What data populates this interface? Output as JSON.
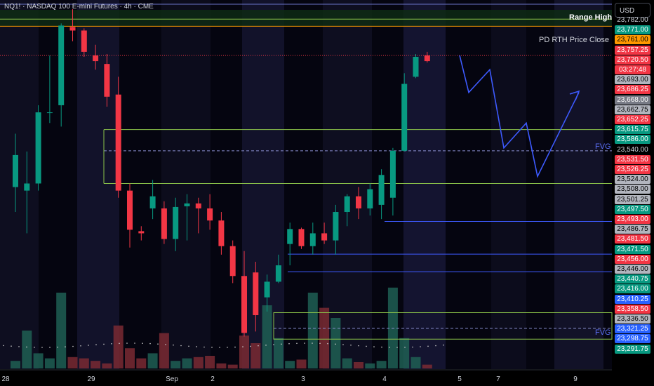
{
  "symbol_title": "NQ1! · NASDAQ 100 E-mini Futures · 4h · CME",
  "currency": "USD",
  "annotations": {
    "range_high": "Range High",
    "pd_rth_close": "PD RTH Price Close",
    "fvg_upper": "FVG",
    "fvg_lower": "FVG"
  },
  "time_labels": [
    "28",
    "29",
    "Sep",
    "2",
    "3",
    "4",
    "5",
    "7",
    "9"
  ],
  "price_labels": [
    {
      "text": "23,782.00",
      "style": "plain"
    },
    {
      "text": "23,771.00",
      "style": "green"
    },
    {
      "text": "23,761.00",
      "style": "orange"
    },
    {
      "text": "23,757.25",
      "style": "red"
    },
    {
      "text": "23,720.50",
      "style": "red"
    },
    {
      "text": "03:27:48",
      "style": "red"
    },
    {
      "text": "23,693.00",
      "style": "gray"
    },
    {
      "text": "23,686.25",
      "style": "red"
    },
    {
      "text": "23,668.00",
      "style": "darkgray"
    },
    {
      "text": "23,662.75",
      "style": "gray"
    },
    {
      "text": "23,652.25",
      "style": "red"
    },
    {
      "text": "23,615.75",
      "style": "green"
    },
    {
      "text": "23,586.00",
      "style": "green"
    },
    {
      "text": "23,540.00",
      "style": "plain"
    },
    {
      "text": "23,531.50",
      "style": "red"
    },
    {
      "text": "23,526.25",
      "style": "red"
    },
    {
      "text": "23,524.00",
      "style": "gray"
    },
    {
      "text": "23,508.00",
      "style": "gray"
    },
    {
      "text": "23,501.25",
      "style": "gray"
    },
    {
      "text": "23,497.50",
      "style": "green"
    },
    {
      "text": "23,493.00",
      "style": "red"
    },
    {
      "text": "23,486.75",
      "style": "gray"
    },
    {
      "text": "23,481.50",
      "style": "red"
    },
    {
      "text": "23,471.50",
      "style": "green"
    },
    {
      "text": "23,456.00",
      "style": "red"
    },
    {
      "text": "23,446.00",
      "style": "gray"
    },
    {
      "text": "23,440.75",
      "style": "green"
    },
    {
      "text": "23,416.00",
      "style": "green"
    },
    {
      "text": "23,410.25",
      "style": "blue"
    },
    {
      "text": "23,358.50",
      "style": "red"
    },
    {
      "text": "23,336.50",
      "style": "gray"
    },
    {
      "text": "23,321.25",
      "style": "blue"
    },
    {
      "text": "23,298.75",
      "style": "blue"
    },
    {
      "text": "23,291.75",
      "style": "green"
    }
  ],
  "colors": {
    "up": "#089981",
    "down": "#f23645",
    "level_green": "#8bc34a",
    "pd_close": "#ff9800",
    "projection": "#3d5afe",
    "fvg_line": "#5b6ef5"
  },
  "chart_data": {
    "type": "candlestick",
    "symbol": "NQ1!",
    "timeframe": "4h",
    "y_axis": {
      "min": 23285,
      "max": 23790
    },
    "candles": [
      {
        "o": 23535,
        "h": 23610,
        "l": 23500,
        "c": 23580
      },
      {
        "o": 23530,
        "h": 23585,
        "l": 23470,
        "c": 23540
      },
      {
        "o": 23540,
        "h": 23650,
        "l": 23530,
        "c": 23640
      },
      {
        "o": 23640,
        "h": 23720,
        "l": 23625,
        "c": 23640
      },
      {
        "o": 23650,
        "h": 23765,
        "l": 23620,
        "c": 23762
      },
      {
        "o": 23760,
        "h": 23785,
        "l": 23740,
        "c": 23755
      },
      {
        "o": 23755,
        "h": 23758,
        "l": 23718,
        "c": 23725
      },
      {
        "o": 23720,
        "h": 23735,
        "l": 23700,
        "c": 23712
      },
      {
        "o": 23708,
        "h": 23722,
        "l": 23648,
        "c": 23662
      },
      {
        "o": 23665,
        "h": 23690,
        "l": 23520,
        "c": 23530
      },
      {
        "o": 23530,
        "h": 23540,
        "l": 23450,
        "c": 23475
      },
      {
        "o": 23473,
        "h": 23480,
        "l": 23460,
        "c": 23470
      },
      {
        "o": 23505,
        "h": 23545,
        "l": 23490,
        "c": 23522
      },
      {
        "o": 23505,
        "h": 23515,
        "l": 23455,
        "c": 23462
      },
      {
        "o": 23462,
        "h": 23520,
        "l": 23445,
        "c": 23507
      },
      {
        "o": 23508,
        "h": 23525,
        "l": 23460,
        "c": 23512
      },
      {
        "o": 23512,
        "h": 23520,
        "l": 23470,
        "c": 23505
      },
      {
        "o": 23505,
        "h": 23525,
        "l": 23475,
        "c": 23488
      },
      {
        "o": 23488,
        "h": 23500,
        "l": 23440,
        "c": 23452
      },
      {
        "o": 23452,
        "h": 23460,
        "l": 23400,
        "c": 23410
      },
      {
        "o": 23410,
        "h": 23445,
        "l": 23325,
        "c": 23330
      },
      {
        "o": 23415,
        "h": 23430,
        "l": 23332,
        "c": 23355
      },
      {
        "o": 23380,
        "h": 23412,
        "l": 23360,
        "c": 23402
      },
      {
        "o": 23402,
        "h": 23440,
        "l": 23400,
        "c": 23425
      },
      {
        "o": 23455,
        "h": 23485,
        "l": 23425,
        "c": 23476
      },
      {
        "o": 23476,
        "h": 23478,
        "l": 23448,
        "c": 23452
      },
      {
        "o": 23452,
        "h": 23485,
        "l": 23440,
        "c": 23470
      },
      {
        "o": 23470,
        "h": 23485,
        "l": 23455,
        "c": 23460
      },
      {
        "o": 23460,
        "h": 23510,
        "l": 23440,
        "c": 23500
      },
      {
        "o": 23500,
        "h": 23525,
        "l": 23480,
        "c": 23522
      },
      {
        "o": 23522,
        "h": 23535,
        "l": 23490,
        "c": 23505
      },
      {
        "o": 23505,
        "h": 23540,
        "l": 23495,
        "c": 23532
      },
      {
        "o": 23510,
        "h": 23560,
        "l": 23490,
        "c": 23552
      },
      {
        "o": 23520,
        "h": 23590,
        "l": 23495,
        "c": 23586
      },
      {
        "o": 23586,
        "h": 23695,
        "l": 23585,
        "c": 23680
      },
      {
        "o": 23690,
        "h": 23722,
        "l": 23688,
        "c": 23718
      },
      {
        "o": 23720,
        "h": 23725,
        "l": 23710,
        "c": 23712
      }
    ],
    "volume": [
      30,
      150,
      60,
      40,
      300,
      45,
      40,
      30,
      20,
      170,
      80,
      40,
      60,
      140,
      30,
      40,
      45,
      50,
      20,
      15,
      130,
      100,
      250,
      120,
      30,
      35,
      300,
      240,
      200,
      40,
      25,
      20,
      30,
      320,
      120,
      45,
      15
    ],
    "horizontal_levels": [
      {
        "price": 23771.0,
        "label": "Range High"
      },
      {
        "price": 23761.0,
        "label": "PD RTH Price Close"
      },
      {
        "price": 23615.75,
        "label": ""
      },
      {
        "price": 23586.0,
        "label": "FVG"
      },
      {
        "price": 23540.0,
        "label": ""
      },
      {
        "price": 23336.5,
        "label": "FVG"
      }
    ],
    "projection_path": [
      [
        23720,
        0
      ],
      [
        23668,
        0
      ],
      [
        23700,
        0
      ],
      [
        23590,
        0
      ],
      [
        23625,
        0
      ],
      [
        23550,
        0
      ],
      [
        23668,
        0
      ]
    ]
  }
}
